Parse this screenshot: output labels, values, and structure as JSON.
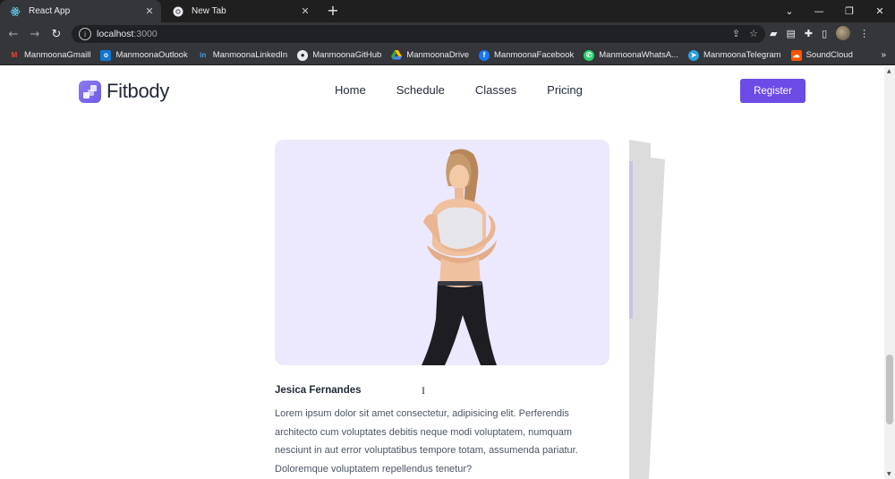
{
  "browser": {
    "tabs": [
      {
        "title": "React App",
        "icon": "react-icon",
        "active": true
      },
      {
        "title": "New Tab",
        "icon": "chrome-icon",
        "active": false
      }
    ],
    "url_host": "localhost",
    "url_port": ":3000",
    "bookmarks": [
      {
        "label": "ManmoonaGmaill",
        "icon": "gmail-icon",
        "color": "#ea4335"
      },
      {
        "label": "ManmoonaOutlook",
        "icon": "outlook-icon",
        "color": "#0f78d4"
      },
      {
        "label": "ManmoonaLinkedIn",
        "icon": "linkedin-icon",
        "color": "#0a66c2"
      },
      {
        "label": "ManmoonaGitHub",
        "icon": "github-icon",
        "color": "#e8eaed"
      },
      {
        "label": "ManmoonaDrive",
        "icon": "drive-icon",
        "color": "#34a853"
      },
      {
        "label": "ManmoonaFacebook",
        "icon": "facebook-icon",
        "color": "#1877f2"
      },
      {
        "label": "ManmoonaWhatsA...",
        "icon": "whatsapp-icon",
        "color": "#25d366"
      },
      {
        "label": "ManmoonaTelegram",
        "icon": "telegram-icon",
        "color": "#2aa1da"
      },
      {
        "label": "SoundCloud",
        "icon": "soundcloud-icon",
        "color": "#ff5500"
      }
    ]
  },
  "site": {
    "brand": "Fitbody",
    "accent": "#6c4be6",
    "nav": [
      "Home",
      "Schedule",
      "Classes",
      "Pricing"
    ],
    "register_label": "Register"
  },
  "trainer": {
    "name": "Jesica Fernandes",
    "bio": "Lorem ipsum dolor sit amet consectetur, adipisicing elit. Perferendis architecto cum voluptates debitis neque modi voluptatem, numquam nesciunt in aut error voluptatibus tempore totam, assumenda pariatur. Doloremque voluptatem repellendus tenetur?",
    "image_bg": "#ece8fd"
  }
}
